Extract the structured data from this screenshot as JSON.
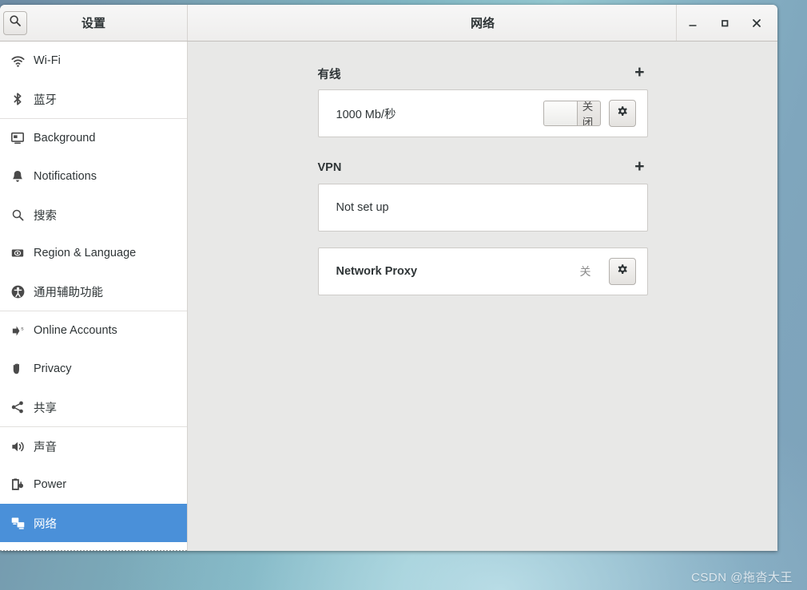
{
  "desktop": {
    "watermark": "CSDN @拖沓大王",
    "background_color": "#7fb5c2"
  },
  "window": {
    "sidebar_header_title": "设置",
    "title": "网络",
    "search_icon": "search-icon",
    "controls": {
      "minimize": "minimize-icon",
      "maximize": "maximize-icon",
      "close": "close-icon"
    }
  },
  "sidebar": {
    "selected_color": "#4a90d9",
    "groups": [
      {
        "items": [
          {
            "label": "Wi-Fi",
            "icon": "wifi-icon",
            "selected": false
          },
          {
            "label": "蓝牙",
            "icon": "bluetooth-icon",
            "selected": false
          }
        ]
      },
      {
        "items": [
          {
            "label": "Background",
            "icon": "background-icon",
            "selected": false
          },
          {
            "label": "Notifications",
            "icon": "bell-icon",
            "selected": false
          },
          {
            "label": "搜索",
            "icon": "search-icon",
            "selected": false
          },
          {
            "label": "Region & Language",
            "icon": "region-language-icon",
            "selected": false
          },
          {
            "label": "通用辅助功能",
            "icon": "accessibility-icon",
            "selected": false
          }
        ]
      },
      {
        "items": [
          {
            "label": "Online Accounts",
            "icon": "online-accounts-icon",
            "selected": false
          },
          {
            "label": "Privacy",
            "icon": "privacy-hand-icon",
            "selected": false
          },
          {
            "label": "共享",
            "icon": "sharing-icon",
            "selected": false
          }
        ]
      },
      {
        "items": [
          {
            "label": "声音",
            "icon": "sound-icon",
            "selected": false
          },
          {
            "label": "Power",
            "icon": "power-battery-icon",
            "selected": false
          },
          {
            "label": "网络",
            "icon": "network-icon",
            "selected": true
          }
        ]
      }
    ]
  },
  "main": {
    "sections": [
      {
        "title": "有线",
        "add_label": "+",
        "rows": [
          {
            "label": "1000 Mb/秒",
            "bold": false,
            "switch": {
              "state_label": "关闭",
              "on": false
            },
            "gear": "gear-icon"
          }
        ]
      },
      {
        "title": "VPN",
        "add_label": "+",
        "rows": [
          {
            "label": "Not set up",
            "bold": false
          }
        ]
      }
    ],
    "proxy": {
      "label": "Network Proxy",
      "state_label": "关",
      "gear": "gear-icon"
    }
  }
}
